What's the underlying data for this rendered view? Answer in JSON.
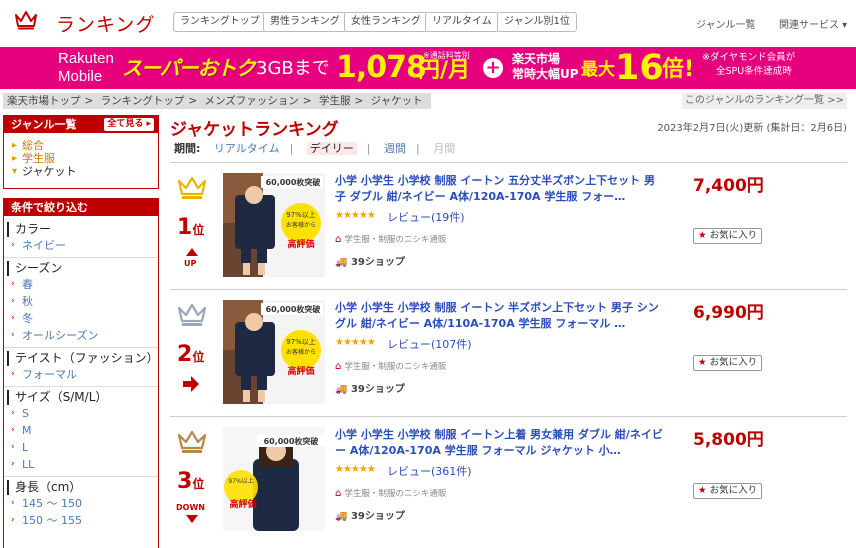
{
  "header": {
    "logo_text": "ランキング",
    "tabs": [
      "ランキングトップ",
      "男性ランキング",
      "女性ランキング",
      "リアルタイム",
      "ジャンル別1位"
    ],
    "genre_list": "ジャンル一覧",
    "related": "関連サービス ▾"
  },
  "banner": {
    "rakuten": "Rakuten",
    "mobile": "Mobile",
    "super": "スーパーおトク",
    "gb": "3GBまで",
    "price": "1,078",
    "yen": "円/月",
    "note1": "※通話料等別",
    "plus": "+",
    "r1": "楽天市場",
    "r2": "常時大幅UP",
    "max": "最大",
    "times": "16",
    "bai": "倍!",
    "n2": "※ダイヤモンド会員が",
    "n3": "全SPU条件達成時"
  },
  "breadcrumb": [
    "楽天市場トップ",
    ">",
    "ランキングトップ",
    ">",
    "メンズファッション",
    ">",
    "学生服",
    ">",
    "ジャケット"
  ],
  "genre_rank_link": "このジャンルのランキング一覧 >>",
  "sidebar": {
    "genre_title": "ジャンル一覧",
    "see_all": "全て見る ▸",
    "genres": [
      "総合",
      "学生服",
      "ジャケット"
    ],
    "filter_title": "条件で絞り込む",
    "sections": [
      {
        "title": "カラー",
        "items": [
          "ネイビー"
        ]
      },
      {
        "title": "シーズン",
        "items": [
          "春",
          "秋",
          "冬",
          "オールシーズン"
        ]
      },
      {
        "title": "テイスト（ファッション）",
        "items": [
          "フォーマル"
        ]
      },
      {
        "title": "サイズ（S/M/L）",
        "items": [
          "S",
          "M",
          "L",
          "LL"
        ]
      },
      {
        "title": "身長（cm）",
        "items": [
          "145 ～ 150",
          "150 ～ 155"
        ]
      }
    ]
  },
  "main": {
    "title": "ジャケットランキング",
    "updated": "2023年2月7日(火)更新 (集計日：2月6日)",
    "period_label": "期間:",
    "periods": [
      "リアルタイム",
      "デイリー",
      "週間",
      "月間"
    ]
  },
  "items": [
    {
      "rank": "1",
      "rank_unit": "位",
      "move": "UP",
      "title": "小学 小学生 小学校 制服 イートン 五分丈半ズボン上下セット 男子 ダブル 紺/ネイビー A体/120A-170A 学生服 フォー…",
      "stars": "★★★★★",
      "review": "レビュー(19件)",
      "shop": "学生服・制服のニシキ通販",
      "ship": "39ショップ",
      "price": "7,400円",
      "fav": "お気に入り",
      "img_badge": "60,000枚突破",
      "img_pct": "97%以上の",
      "img_text": "高評価"
    },
    {
      "rank": "2",
      "rank_unit": "位",
      "move": "",
      "title": "小学 小学生 小学校 制服 イートン 半ズボン上下セット 男子 シングル 紺/ネイビー A体/110A-170A 学生服 フォーマル …",
      "stars": "★★★★★",
      "review": "レビュー(107件)",
      "shop": "学生服・制服のニシキ通販",
      "ship": "39ショップ",
      "price": "6,990円",
      "fav": "お気に入り",
      "img_badge": "60,000枚突破",
      "img_pct": "97%以上の",
      "img_text": "高評価"
    },
    {
      "rank": "3",
      "rank_unit": "位",
      "move": "DOWN",
      "title": "小学 小学生 小学校 制服 イートン上着 男女兼用 ダブル 紺/ネイビー A体/120A-170A 学生服 フォーマル ジャケット 小…",
      "stars": "★★★★★",
      "review": "レビュー(361件)",
      "shop": "学生服・制服のニシキ通販",
      "ship": "39ショップ",
      "price": "5,800円",
      "fav": "お気に入り",
      "img_badge": "60,000枚突破",
      "img_pct": "97%以上の",
      "img_text": "高評価"
    }
  ],
  "colors": {
    "accent": "#bf0000",
    "banner": "#e6007e",
    "link": "#2a4dbc",
    "gold": "#e8b600",
    "silver": "#9aa7b8",
    "bronze": "#b8884a"
  }
}
